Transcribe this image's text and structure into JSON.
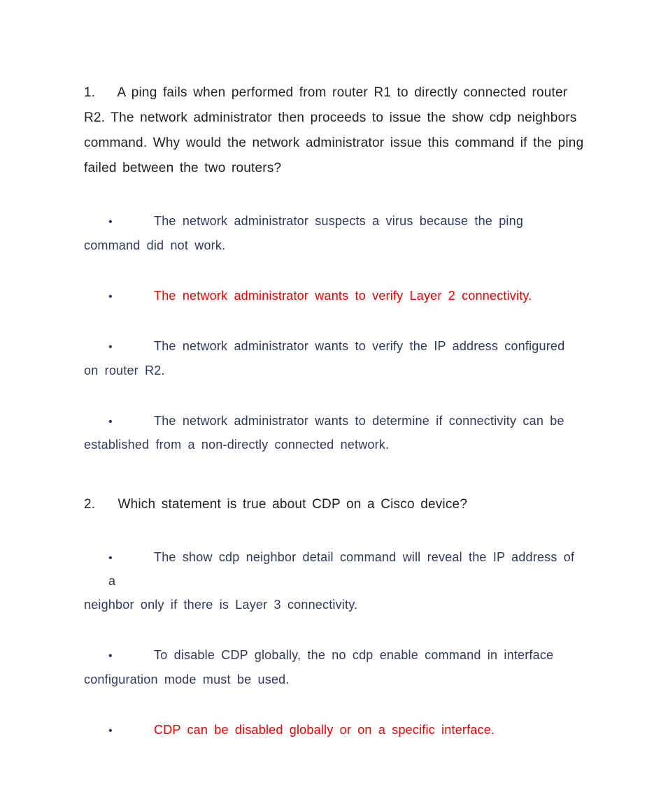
{
  "questions": [
    {
      "number": "1.",
      "text": "A ping fails when performed from router R1 to directly connected router R2. The network administrator then proceeds to issue the show cdp neighbors command. Why would the network administrator issue this command if the ping failed between the two routers?",
      "answers": [
        {
          "first": "The  network  administrator  suspects  a  virus  because  the  ping",
          "cont": "command did not work.",
          "correct": false
        },
        {
          "first": "The network administrator wants to verify Layer 2 connectivity.",
          "cont": "",
          "correct": true
        },
        {
          "first": "The network administrator wants to verify the IP address configured",
          "cont": "on router R2.",
          "correct": false
        },
        {
          "first": "The network administrator wants to determine if connectivity can be",
          "cont": "established from a non-directly connected network.",
          "correct": false
        }
      ]
    },
    {
      "number": "2.",
      "text": "Which statement is true about CDP on a Cisco device?",
      "answers": [
        {
          "first": "The show cdp neighbor detail command will reveal the IP address of a",
          "cont": "neighbor only if there is Layer 3 connectivity.",
          "correct": false
        },
        {
          "first": "To disable CDP globally, the no cdp enable command in interface",
          "cont": "configuration mode must be used.",
          "correct": false
        },
        {
          "first": "CDP can be disabled globally or on a specific interface.",
          "cont": "",
          "correct": true
        }
      ]
    }
  ]
}
